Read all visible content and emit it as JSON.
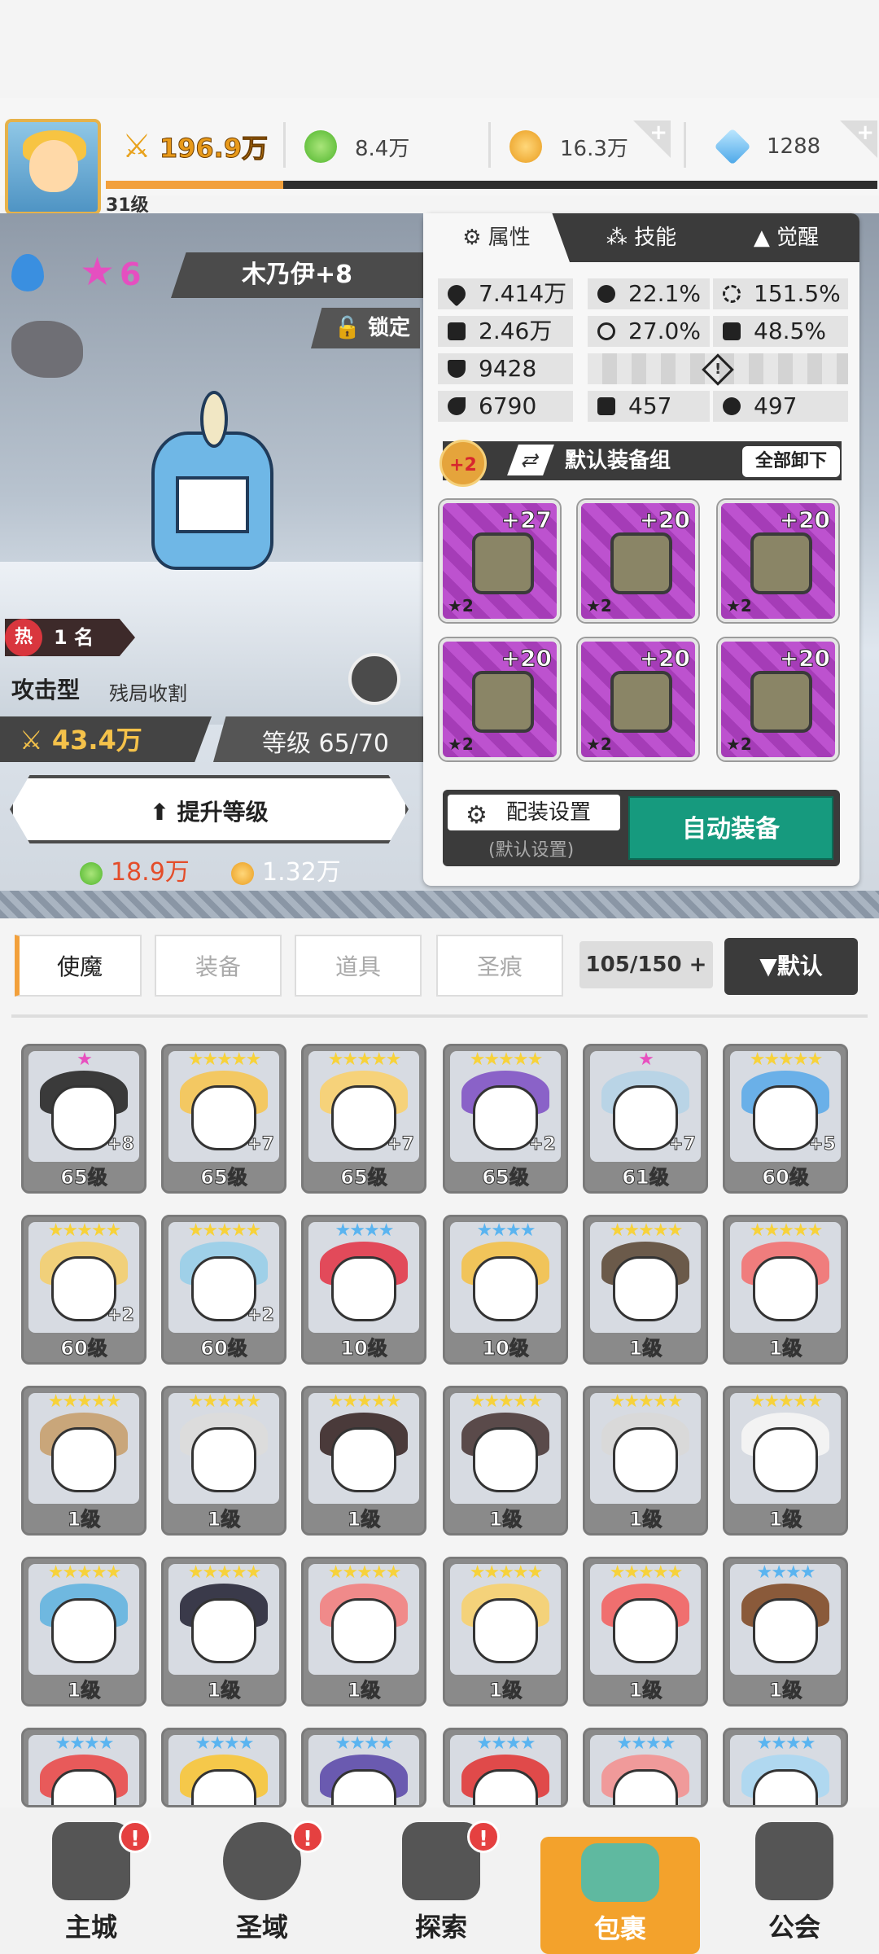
{
  "player": {
    "level": "31级",
    "power": "196.9万"
  },
  "resources": {
    "green": "8.4万",
    "gold": "16.3万",
    "crystal": "1288",
    "add_label": "+"
  },
  "hero": {
    "stars": "6",
    "name": "木乃伊+8",
    "lock_label": "锁定",
    "hot_icon": "热",
    "rank": "1 名",
    "type": "攻击型",
    "role": "残局收割",
    "power": "43.4万",
    "level_text": "等级 65/70",
    "levelup_label": "提升等级",
    "cost_green": "18.9万",
    "cost_gold": "1.32万"
  },
  "panel": {
    "tabs": [
      "属性",
      "技能",
      "觉醒"
    ],
    "stats": {
      "hp": "7.414万",
      "crit": "22.1%",
      "crit_dmg": "151.5%",
      "atk": "2.46万",
      "accuracy": "27.0%",
      "dodge": "48.5%",
      "def": "9428",
      "spd": "6790",
      "s1": "457",
      "s2": "497"
    },
    "set_plus": "+2",
    "set_name": "默认装备组",
    "unload_label": "全部卸下",
    "equipment": [
      {
        "level": "+27",
        "stars": "★2",
        "icon": "sword-icon"
      },
      {
        "level": "+20",
        "stars": "★2",
        "icon": "helmet-icon"
      },
      {
        "level": "+20",
        "stars": "★2",
        "icon": "armor-icon"
      },
      {
        "level": "+20",
        "stars": "★2",
        "icon": "belt-icon"
      },
      {
        "level": "+20",
        "stars": "★2",
        "icon": "necklace-icon"
      },
      {
        "level": "+20",
        "stars": "★2",
        "icon": "boots-icon"
      }
    ],
    "config_label": "配装设置",
    "config_sub": "(默认设置)",
    "auto_label": "自动装备"
  },
  "inventory": {
    "categories": [
      "使魔",
      "装备",
      "道具",
      "圣痕"
    ],
    "count": "105/150",
    "count_add": "+",
    "sort_label": "▼默认",
    "cards": [
      {
        "level": "65级",
        "plus": "+8",
        "stars": "★"
      },
      {
        "level": "65级",
        "plus": "+7",
        "stars": "★★★★★"
      },
      {
        "level": "65级",
        "plus": "+7",
        "stars": "★★★★★"
      },
      {
        "level": "65级",
        "plus": "+2",
        "stars": "★★★★★"
      },
      {
        "level": "61级",
        "plus": "+7",
        "stars": "★"
      },
      {
        "level": "60级",
        "plus": "+5",
        "stars": "★★★★★"
      },
      {
        "level": "60级",
        "plus": "+2",
        "stars": "★★★★★"
      },
      {
        "level": "60级",
        "plus": "+2",
        "stars": "★★★★★"
      },
      {
        "level": "10级",
        "plus": "",
        "stars": "★★★★"
      },
      {
        "level": "10级",
        "plus": "",
        "stars": "★★★★"
      },
      {
        "level": "1级",
        "plus": "",
        "stars": "★★★★★"
      },
      {
        "level": "1级",
        "plus": "",
        "stars": "★★★★★"
      },
      {
        "level": "1级",
        "plus": "",
        "stars": "★★★★★"
      },
      {
        "level": "1级",
        "plus": "",
        "stars": "★★★★★"
      },
      {
        "level": "1级",
        "plus": "",
        "stars": "★★★★★"
      },
      {
        "level": "1级",
        "plus": "",
        "stars": "★★★★★"
      },
      {
        "level": "1级",
        "plus": "",
        "stars": "★★★★★"
      },
      {
        "level": "1级",
        "plus": "",
        "stars": "★★★★★"
      },
      {
        "level": "1级",
        "plus": "",
        "stars": "★★★★★"
      },
      {
        "level": "1级",
        "plus": "",
        "stars": "★★★★★"
      },
      {
        "level": "1级",
        "plus": "",
        "stars": "★★★★★"
      },
      {
        "level": "1级",
        "plus": "",
        "stars": "★★★★★"
      },
      {
        "level": "1级",
        "plus": "",
        "stars": "★★★★★"
      },
      {
        "level": "1级",
        "plus": "",
        "stars": "★★★★"
      },
      {
        "level": "",
        "plus": "",
        "stars": "★★★★"
      },
      {
        "level": "",
        "plus": "",
        "stars": "★★★★"
      },
      {
        "level": "",
        "plus": "",
        "stars": "★★★★"
      },
      {
        "level": "",
        "plus": "",
        "stars": "★★★★"
      },
      {
        "level": "",
        "plus": "",
        "stars": "★★★★"
      },
      {
        "level": "",
        "plus": "",
        "stars": "★★★★"
      }
    ]
  },
  "nav": {
    "items": [
      "主城",
      "圣域",
      "探索",
      "包裹",
      "公会"
    ],
    "alert": "!"
  },
  "colors": {
    "accent": "#f3a22c",
    "auto_button": "#169a7e",
    "equip_purple": "#a53cb7"
  }
}
